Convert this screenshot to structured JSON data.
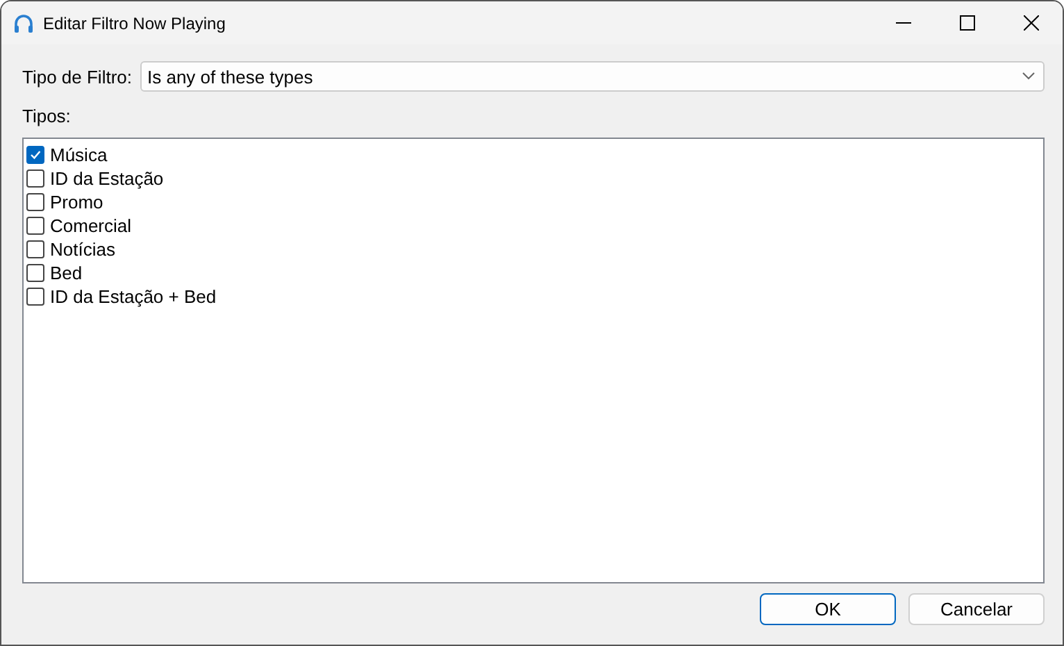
{
  "window": {
    "title": "Editar Filtro Now Playing"
  },
  "filter_type": {
    "label": "Tipo de Filtro:",
    "value": "Is any of these types"
  },
  "types": {
    "label": "Tipos:",
    "items": [
      {
        "label": "Música",
        "checked": true
      },
      {
        "label": "ID da Estação",
        "checked": false
      },
      {
        "label": "Promo",
        "checked": false
      },
      {
        "label": "Comercial",
        "checked": false
      },
      {
        "label": "Notícias",
        "checked": false
      },
      {
        "label": "Bed",
        "checked": false
      },
      {
        "label": "ID da Estação + Bed",
        "checked": false
      }
    ]
  },
  "buttons": [
    {
      "label": "OK",
      "default": true
    },
    {
      "label": "Cancelar",
      "default": false
    }
  ]
}
